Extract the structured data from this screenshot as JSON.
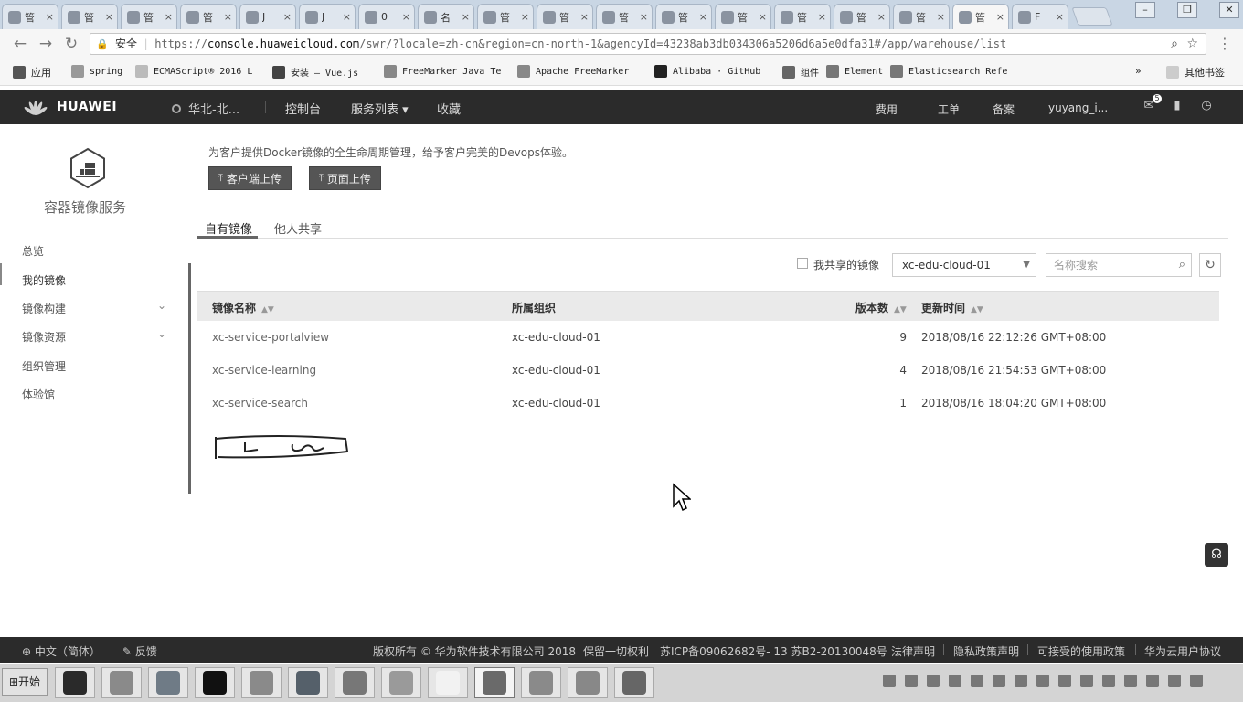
{
  "browser": {
    "tabs": [
      {
        "label": "管"
      },
      {
        "label": "管"
      },
      {
        "label": "管"
      },
      {
        "label": "管"
      },
      {
        "label": "J"
      },
      {
        "label": "J"
      },
      {
        "label": "0"
      },
      {
        "label": "名"
      },
      {
        "label": "管"
      },
      {
        "label": "管"
      },
      {
        "label": "管"
      },
      {
        "label": "管"
      },
      {
        "label": "管"
      },
      {
        "label": "管"
      },
      {
        "label": "管"
      },
      {
        "label": "管"
      },
      {
        "label": "管",
        "active": true
      },
      {
        "label": "F"
      }
    ],
    "close_glyph": "×",
    "secure_label": "安全",
    "url_scheme": "https://",
    "url_host": "console.huaweicloud.com",
    "url_rest": "/swr/?locale=zh-cn&region=cn-north-1&agencyId=43238ab3db034306a5206d6a5e0dfa31#/app/warehouse/list",
    "bookmarks": [
      {
        "label": "应用",
        "icon": "apps-icon",
        "color": "#555555"
      },
      {
        "label": "spring",
        "icon": "folder-icon",
        "color": "#999999"
      },
      {
        "label": "ECMAScript® 2016 L",
        "icon": "page-icon",
        "color": "#bbbbbb"
      },
      {
        "label": "安装 — Vue.js",
        "icon": "vue-icon",
        "color": "#444444"
      },
      {
        "label": "FreeMarker Java Te",
        "icon": "hash-icon",
        "color": "#888888"
      },
      {
        "label": "Apache FreeMarker",
        "icon": "hash-icon",
        "color": "#888888"
      },
      {
        "label": "Alibaba · GitHub",
        "icon": "github-icon",
        "color": "#222222"
      },
      {
        "label": "组件",
        "icon": "element-icon",
        "color": "#666666"
      },
      {
        "label": "Element",
        "icon": "element-icon",
        "color": "#777777"
      },
      {
        "label": "Elasticsearch Refe",
        "icon": "gear-icon",
        "color": "#777777"
      }
    ],
    "more_bookmarks": "»",
    "other_bookmarks": "其他书签"
  },
  "header": {
    "brand": "HUAWEI",
    "region": "华北-北...",
    "nav": [
      "控制台",
      "服务列表 ▾",
      "收藏"
    ],
    "right": [
      "费用",
      "工单",
      "备案",
      "yuyang_i..."
    ],
    "msg_count": "5"
  },
  "sidebar": {
    "service_title": "容器镜像服务",
    "items": [
      {
        "label": "总览",
        "expandable": false
      },
      {
        "label": "我的镜像",
        "expandable": false,
        "active": true
      },
      {
        "label": "镜像构建",
        "expandable": true
      },
      {
        "label": "镜像资源",
        "expandable": true
      },
      {
        "label": "组织管理",
        "expandable": false
      },
      {
        "label": "体验馆",
        "expandable": false
      }
    ],
    "chevron": "⌄"
  },
  "main": {
    "intro": "为客户提供Docker镜像的全生命周期管理，给予客户完美的Devops体验。",
    "client_upload": "客户端上传",
    "page_upload": "页面上传",
    "tabs": [
      "自有镜像",
      "他人共享"
    ],
    "shared_by_me": "我共享的镜像",
    "org_select": "xc-edu-cloud-01",
    "search_placeholder": "名称搜索",
    "table": {
      "headers": [
        "镜像名称",
        "所属组织",
        "版本数",
        "更新时间"
      ],
      "rows": [
        {
          "name": "xc-service-portalview",
          "org": "xc-edu-cloud-01",
          "versions": "9",
          "updated": "2018/08/16 22:12:26 GMT+08:00"
        },
        {
          "name": "xc-service-learning",
          "org": "xc-edu-cloud-01",
          "versions": "4",
          "updated": "2018/08/16 21:54:53 GMT+08:00"
        },
        {
          "name": "xc-service-search",
          "org": "xc-edu-cloud-01",
          "versions": "1",
          "updated": "2018/08/16 18:04:20 GMT+08:00"
        }
      ]
    }
  },
  "footer": {
    "lang": "中文（简体）",
    "feedback": "反馈",
    "copyright": "版权所有 © 华为软件技术有限公司 2018",
    "rights": "保留一切权利",
    "icp": "苏ICP备09062682号- 13 苏B2-20130048号",
    "links": [
      "法律声明",
      "隐私政策声明",
      "可接受的使用政策",
      "华为云用户协议"
    ]
  },
  "taskbar": {
    "start": "开始",
    "apps": [
      {
        "name": "webstorm-icon",
        "color": "#2a2a2a"
      },
      {
        "name": "app-icon",
        "color": "#8a8a8a"
      },
      {
        "name": "cloud-icon",
        "color": "#6f7b86"
      },
      {
        "name": "terminal-icon",
        "color": "#111111"
      },
      {
        "name": "app-icon",
        "color": "#8a8a8a"
      },
      {
        "name": "vm-icon",
        "color": "#55606a"
      },
      {
        "name": "idea-icon",
        "color": "#777777"
      },
      {
        "name": "app-icon",
        "color": "#9a9a9a"
      },
      {
        "name": "typora-icon",
        "color": "#f2f2f2"
      },
      {
        "name": "chrome-icon",
        "color": "#6a6a6a"
      },
      {
        "name": "app-icon",
        "color": "#8a8a8a"
      },
      {
        "name": "app-icon",
        "color": "#888888"
      },
      {
        "name": "app-icon",
        "color": "#666666"
      }
    ]
  },
  "colors": {
    "header_bg": "#2b2b2b",
    "footer_bg": "#2b2b2b",
    "table_header_bg": "#eaeaea",
    "upload_btn_bg": "#555555"
  }
}
